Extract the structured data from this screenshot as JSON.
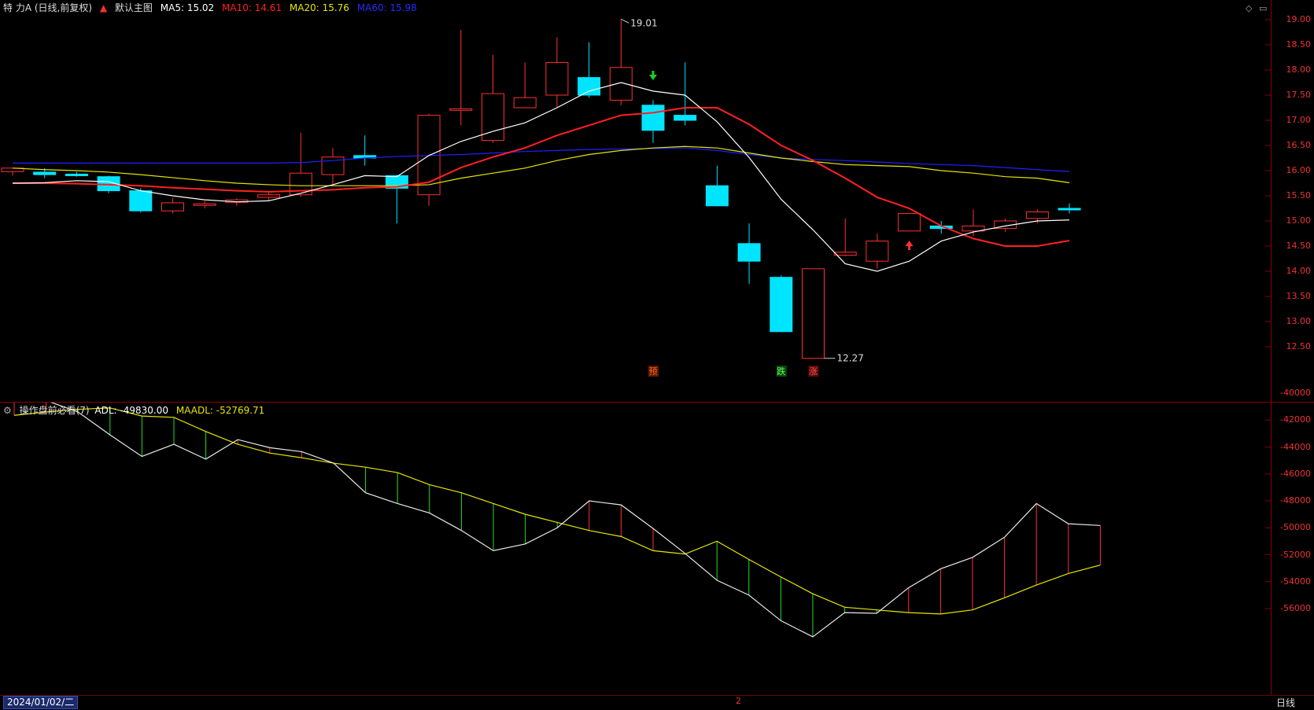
{
  "main_header": {
    "stock_name": "特 力A (日线,前复权)",
    "template": "默认主图",
    "ma5_label": "MA5: 15.02",
    "ma10_label": "MA10: 14.61",
    "ma20_label": "MA20: 15.76",
    "ma60_label": "MA60: 15.98"
  },
  "sub_header": {
    "indicator": "操作盘前必看(7)",
    "adl_label": "ADL: -49830.00",
    "maadl_label": "MAADL: -52769.71"
  },
  "colors": {
    "ma5": "#ffffff",
    "ma10": "#ff2020",
    "ma20": "#e6e600",
    "ma60": "#2020ff",
    "up": "#ff3030",
    "down": "#00e5ff",
    "axis": "#ff3030"
  },
  "price_axis": [
    "19.00",
    "18.50",
    "18.00",
    "17.50",
    "17.00",
    "16.50",
    "16.00",
    "15.50",
    "15.00",
    "14.50",
    "14.00",
    "13.50",
    "13.00",
    "12.50"
  ],
  "sub_axis": [
    "-40000",
    "-42000",
    "-44000",
    "-46000",
    "-48000",
    "-50000",
    "-52000",
    "-54000",
    "-56000"
  ],
  "annotations": {
    "high_label": "19.01",
    "low_label": "12.27",
    "mark_yu": "预",
    "mark_die": "跌",
    "mark_zhang": "涨"
  },
  "footer": {
    "date": "2024/01/02/二",
    "period": "日线",
    "mid_mark": "2"
  },
  "chart_data": [
    {
      "type": "candlestick",
      "title": "特 力A (日线,前复权)",
      "ylim": [
        12.0,
        19.2
      ],
      "candles": [
        {
          "o": 15.98,
          "h": 16.05,
          "l": 15.9,
          "c": 16.05
        },
        {
          "o": 15.97,
          "h": 16.05,
          "l": 15.85,
          "c": 15.92
        },
        {
          "o": 15.93,
          "h": 15.98,
          "l": 15.88,
          "c": 15.9
        },
        {
          "o": 15.88,
          "h": 15.9,
          "l": 15.55,
          "c": 15.6
        },
        {
          "o": 15.6,
          "h": 15.65,
          "l": 15.17,
          "c": 15.2
        },
        {
          "o": 15.2,
          "h": 15.45,
          "l": 15.15,
          "c": 15.36
        },
        {
          "o": 15.32,
          "h": 15.4,
          "l": 15.25,
          "c": 15.34
        },
        {
          "o": 15.37,
          "h": 15.45,
          "l": 15.3,
          "c": 15.42
        },
        {
          "o": 15.47,
          "h": 15.6,
          "l": 15.4,
          "c": 15.52
        },
        {
          "o": 15.52,
          "h": 16.75,
          "l": 15.48,
          "c": 15.95
        },
        {
          "o": 15.92,
          "h": 16.45,
          "l": 15.72,
          "c": 16.27
        },
        {
          "o": 16.3,
          "h": 16.7,
          "l": 16.1,
          "c": 16.25
        },
        {
          "o": 15.9,
          "h": 15.92,
          "l": 14.95,
          "c": 15.65
        },
        {
          "o": 15.52,
          "h": 17.13,
          "l": 15.3,
          "c": 17.1
        },
        {
          "o": 17.2,
          "h": 18.8,
          "l": 16.9,
          "c": 17.23
        },
        {
          "o": 16.6,
          "h": 18.3,
          "l": 16.55,
          "c": 17.53
        },
        {
          "o": 17.25,
          "h": 18.15,
          "l": 17.25,
          "c": 17.45
        },
        {
          "o": 17.5,
          "h": 18.65,
          "l": 17.25,
          "c": 18.15
        },
        {
          "o": 17.85,
          "h": 18.55,
          "l": 17.45,
          "c": 17.5
        },
        {
          "o": 17.4,
          "h": 19.01,
          "l": 17.3,
          "c": 18.05
        },
        {
          "o": 17.3,
          "h": 17.4,
          "l": 16.55,
          "c": 16.8
        },
        {
          "o": 17.1,
          "h": 18.15,
          "l": 16.9,
          "c": 17.0
        },
        {
          "o": 15.7,
          "h": 16.1,
          "l": 15.3,
          "c": 15.3
        },
        {
          "o": 14.55,
          "h": 14.95,
          "l": 13.75,
          "c": 14.2
        },
        {
          "o": 13.88,
          "h": 13.92,
          "l": 12.8,
          "c": 12.8
        },
        {
          "o": 12.27,
          "h": 14.05,
          "l": 12.27,
          "c": 14.05
        },
        {
          "o": 14.32,
          "h": 15.05,
          "l": 14.3,
          "c": 14.38
        },
        {
          "o": 14.2,
          "h": 14.75,
          "l": 14.05,
          "c": 14.6
        },
        {
          "o": 14.8,
          "h": 15.15,
          "l": 14.8,
          "c": 15.15
        },
        {
          "o": 14.9,
          "h": 15.0,
          "l": 14.75,
          "c": 14.85
        },
        {
          "o": 14.8,
          "h": 15.23,
          "l": 14.7,
          "c": 14.9
        },
        {
          "o": 14.85,
          "h": 15.05,
          "l": 14.78,
          "c": 15.0
        },
        {
          "o": 15.05,
          "h": 15.23,
          "l": 14.95,
          "c": 15.18
        },
        {
          "o": 15.25,
          "h": 15.35,
          "l": 15.15,
          "c": 15.22
        }
      ],
      "ma5": [
        15.75,
        15.76,
        15.8,
        15.78,
        15.6,
        15.5,
        15.42,
        15.38,
        15.4,
        15.55,
        15.72,
        15.9,
        15.88,
        16.3,
        16.58,
        16.78,
        16.95,
        17.25,
        17.58,
        17.75,
        17.58,
        17.5,
        16.97,
        16.26,
        15.43,
        14.82,
        14.15,
        14.0,
        14.2,
        14.6,
        14.78,
        14.9,
        15.0,
        15.02
      ],
      "ma10": [
        15.75,
        15.75,
        15.74,
        15.72,
        15.7,
        15.66,
        15.63,
        15.6,
        15.58,
        15.6,
        15.62,
        15.66,
        15.68,
        15.77,
        16.06,
        16.27,
        16.45,
        16.7,
        16.9,
        17.1,
        17.15,
        17.25,
        17.25,
        16.92,
        16.5,
        16.2,
        15.85,
        15.47,
        15.25,
        14.9,
        14.65,
        14.5,
        14.5,
        14.61
      ],
      "ma20": [
        16.05,
        16.02,
        16.0,
        15.97,
        15.92,
        15.86,
        15.8,
        15.75,
        15.72,
        15.7,
        15.7,
        15.7,
        15.7,
        15.72,
        15.85,
        15.95,
        16.05,
        16.2,
        16.32,
        16.4,
        16.45,
        16.48,
        16.45,
        16.35,
        16.25,
        16.18,
        16.12,
        16.1,
        16.08,
        16.0,
        15.95,
        15.88,
        15.85,
        15.76
      ],
      "ma60": [
        16.15,
        16.15,
        16.15,
        16.15,
        16.15,
        16.15,
        16.15,
        16.15,
        16.15,
        16.16,
        16.2,
        16.25,
        16.28,
        16.3,
        16.32,
        16.35,
        16.38,
        16.4,
        16.42,
        16.43,
        16.44,
        16.45,
        16.4,
        16.32,
        16.25,
        16.22,
        16.2,
        16.17,
        16.14,
        16.12,
        16.1,
        16.06,
        16.02,
        15.98
      ]
    },
    {
      "type": "line",
      "title": "操作盘前必看(7)",
      "ylim": [
        -58500,
        -39000
      ],
      "series": [
        {
          "name": "ADL",
          "values": [
            -39950,
            -40550,
            -41400,
            -43100,
            -44700,
            -43800,
            -44900,
            -43450,
            -44050,
            -44350,
            -45200,
            -47400,
            -48200,
            -48900,
            -50200,
            -51700,
            -51200,
            -50000,
            -48000,
            -48300,
            -50050,
            -51900,
            -53900,
            -55000,
            -56900,
            -58100,
            -56300,
            -56350,
            -54450,
            -53050,
            -52200,
            -50700,
            -48200,
            -49700,
            -49830
          ]
        },
        {
          "name": "MAADL",
          "values": [
            -41650,
            -41400,
            -41200,
            -41100,
            -41700,
            -41800,
            -42850,
            -43800,
            -44450,
            -44800,
            -45200,
            -45500,
            -45900,
            -46800,
            -47400,
            -48200,
            -49000,
            -49600,
            -50200,
            -50650,
            -51700,
            -51950,
            -51000,
            -52350,
            -53650,
            -54900,
            -55900,
            -56100,
            -56300,
            -56400,
            -56100,
            -55200,
            -54250,
            -53400,
            -52770
          ]
        }
      ]
    }
  ]
}
